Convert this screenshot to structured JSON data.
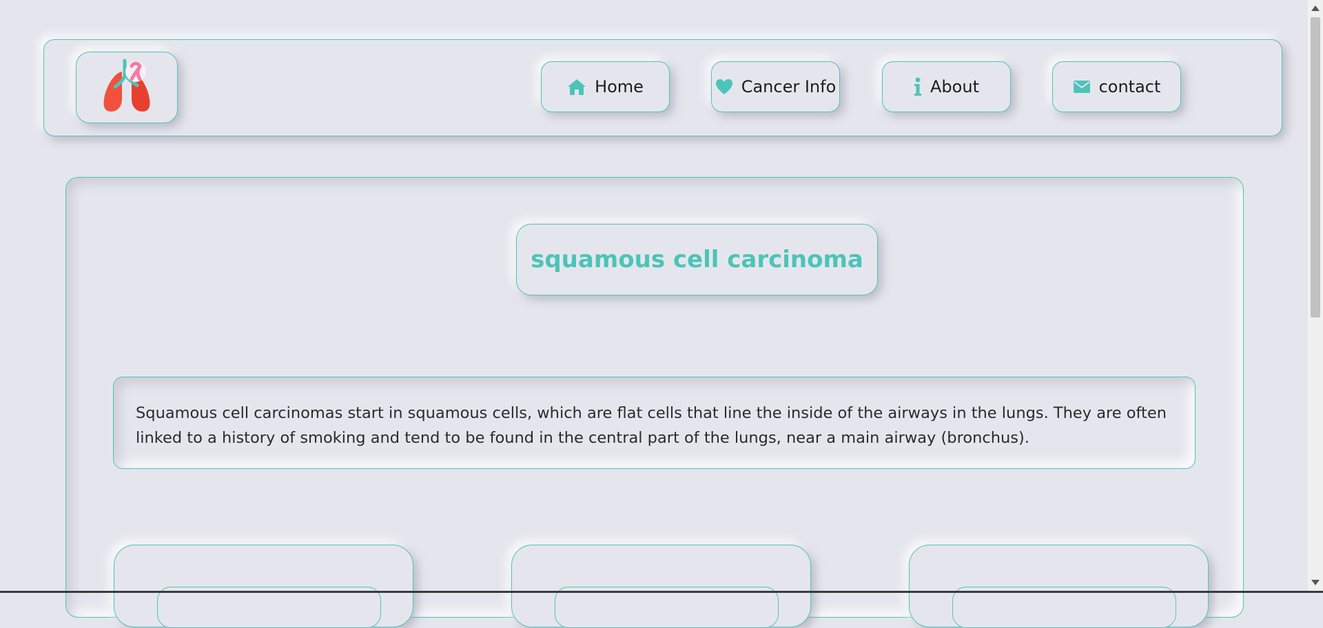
{
  "nav": {
    "logo_icon": "lungs-ribbon-icon",
    "items": [
      {
        "label": "Home",
        "icon": "home-icon"
      },
      {
        "label": "Cancer Info",
        "icon": "heart-icon"
      },
      {
        "label": "About",
        "icon": "info-icon"
      },
      {
        "label": "contact",
        "icon": "envelope-icon"
      }
    ]
  },
  "main": {
    "title": "squamous cell carcinoma",
    "description": "Squamous cell carcinomas start in squamous cells, which are flat cells that line the inside of the airways in the lungs. They are often linked to a history of smoking and tend to be found in the central part of the lungs, near a main airway (bronchus)."
  },
  "colors": {
    "accent": "#4cc4b8",
    "background": "#e5e6ed",
    "lung": "#f0503c",
    "ribbon": "#f27ba8"
  }
}
